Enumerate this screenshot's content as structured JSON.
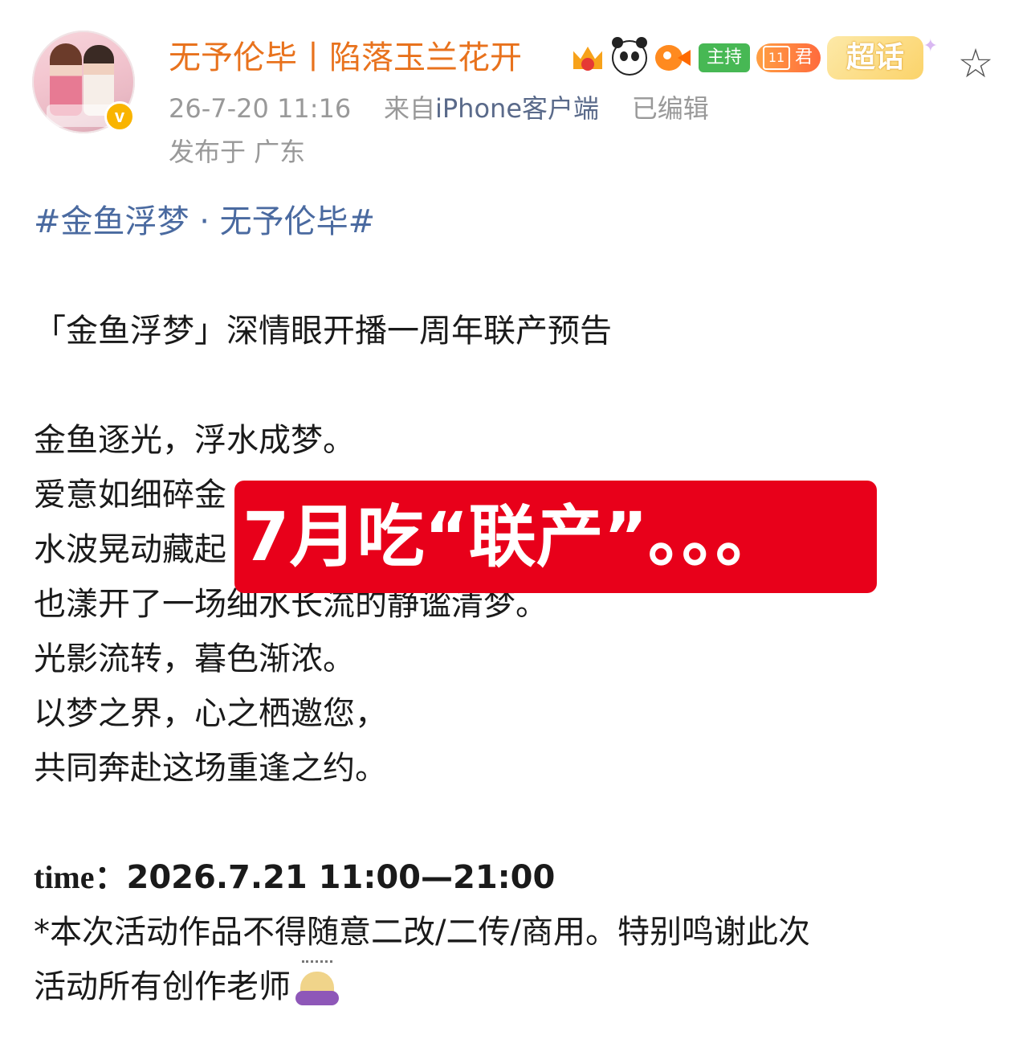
{
  "post": {
    "author": "无予伦毕丨陷落玉兰花开",
    "badges": {
      "host_label": "主持",
      "level_number": "11",
      "level_label": "君",
      "supertopic_label": "超话"
    },
    "timestamp": "26-7-20 11:16",
    "source_prefix": "来自",
    "source_client": "iPhone客户端",
    "edited_label": "已编辑",
    "location": "发布于 广东",
    "icons": {
      "avatar": "avatar-image",
      "verified": "verified-v-badge",
      "crown": "crown-icon",
      "panda": "panda-icon",
      "fish": "goldfish-icon",
      "favorite": "star-icon",
      "bow": "person-bowing-emoji"
    },
    "verified_mark": "v",
    "favorite_glyph": "☆"
  },
  "content": {
    "hashtag": "#金鱼浮梦 · 无予伦毕#",
    "title_line": "「金鱼浮梦」深情眼开播一周年联产预告",
    "poem": [
      "金鱼逐光，浮水成梦。",
      "爱意如细碎金",
      "水波晃动藏起",
      "也漾开了一场细水长流的静谧清梦。",
      "光影流转，暮色渐浓。",
      "以梦之界，心之栖邀您，",
      "共同奔赴这场重逢之约。"
    ],
    "time_label": "time：",
    "time_value": "2026.7.21 11:00—21:00",
    "notice_line1": "*本次活动作品不得随意二改/二传/商用。特别鸣谢此次",
    "notice_line2": "活动所有创作老师"
  },
  "overlay": {
    "text": "7月吃“联产”。。。",
    "color": "#e8001a"
  },
  "colors": {
    "username": "#e8721d",
    "hashtag": "#4a6aa0",
    "meta": "#999999",
    "client": "#5a6a8a"
  }
}
